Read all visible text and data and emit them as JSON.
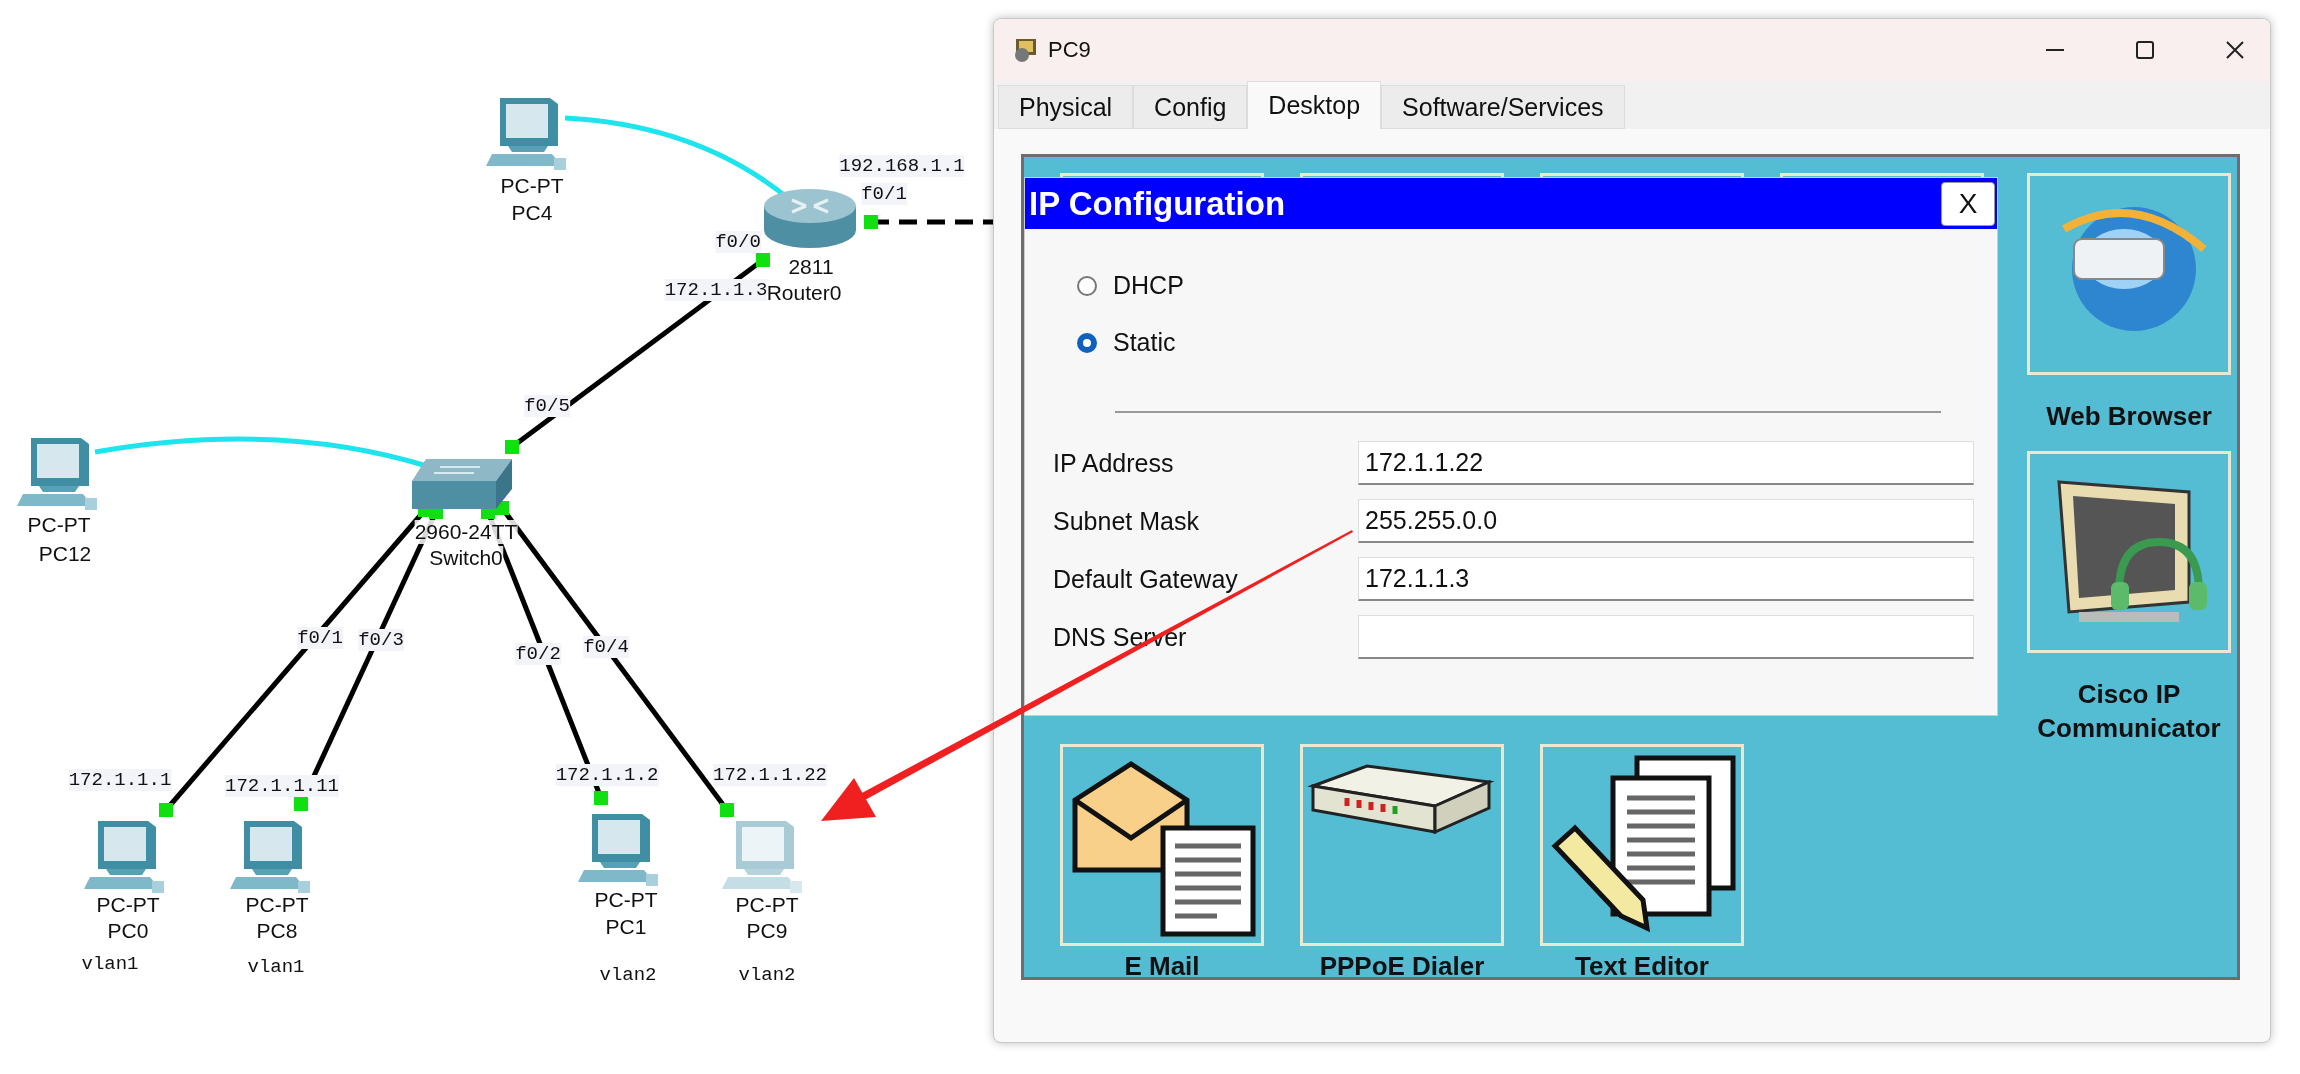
{
  "topology": {
    "devices": [
      {
        "kind": "pc",
        "model": "PC-PT",
        "name": "PC4"
      },
      {
        "kind": "router",
        "model": "2811",
        "name": "Router0"
      },
      {
        "kind": "pc",
        "model": "PC-PT",
        "name": "PC12"
      },
      {
        "kind": "switch",
        "model": "2960-24TT",
        "name": "Switch0"
      },
      {
        "kind": "pc",
        "model": "PC-PT",
        "name": "PC0",
        "vlan": "vlan1"
      },
      {
        "kind": "pc",
        "model": "PC-PT",
        "name": "PC8",
        "vlan": "vlan1"
      },
      {
        "kind": "pc",
        "model": "PC-PT",
        "name": "PC1",
        "vlan": "vlan2"
      },
      {
        "kind": "pc",
        "model": "PC-PT",
        "name": "PC9",
        "vlan": "vlan2",
        "dimmed": true
      }
    ],
    "links": [
      {
        "kind": "console"
      },
      {
        "kind": "console"
      },
      {
        "kind": "straight",
        "labels": [
          "172.1.1.3",
          "f0/0",
          "f0/5"
        ]
      },
      {
        "kind": "crossover",
        "labels": [
          "192.168.1.1",
          "f0/1"
        ]
      },
      {
        "kind": "straight",
        "labels": [
          "f0/1",
          "172.1.1.1"
        ]
      },
      {
        "kind": "straight",
        "labels": [
          "f0/3",
          "172.1.1.11"
        ]
      },
      {
        "kind": "straight",
        "labels": [
          "f0/2",
          "172.1.1.2"
        ]
      },
      {
        "kind": "straight",
        "labels": [
          "f0/4",
          "172.1.1.22"
        ]
      }
    ]
  },
  "window": {
    "title": "PC9",
    "tabs": [
      {
        "label": "Physical",
        "selected": false
      },
      {
        "label": "Config",
        "selected": false
      },
      {
        "label": "Desktop",
        "selected": true
      },
      {
        "label": "Software/Services",
        "selected": false
      }
    ],
    "desktop": {
      "side_apps": [
        {
          "kind": "browser",
          "label": "Web Browser"
        },
        {
          "kind": "phone",
          "label": "Cisco IP Communicator"
        }
      ],
      "bottom_apps": [
        {
          "kind": "mail",
          "label": "E Mail"
        },
        {
          "kind": "dialer",
          "label": "PPPoE Dialer"
        },
        {
          "kind": "editor",
          "label": "Text Editor"
        }
      ]
    },
    "dialog": {
      "title": "IP Configuration",
      "close": "X",
      "modes": [
        {
          "label": "DHCP",
          "selected": false
        },
        {
          "label": "Static",
          "selected": true
        }
      ],
      "fields": [
        {
          "label": "IP Address",
          "value": "172.1.1.22"
        },
        {
          "label": "Subnet Mask",
          "value": "255.255.0.0"
        },
        {
          "label": "Default Gateway",
          "value": "172.1.1.3"
        },
        {
          "label": "DNS Server"
        }
      ]
    }
  }
}
